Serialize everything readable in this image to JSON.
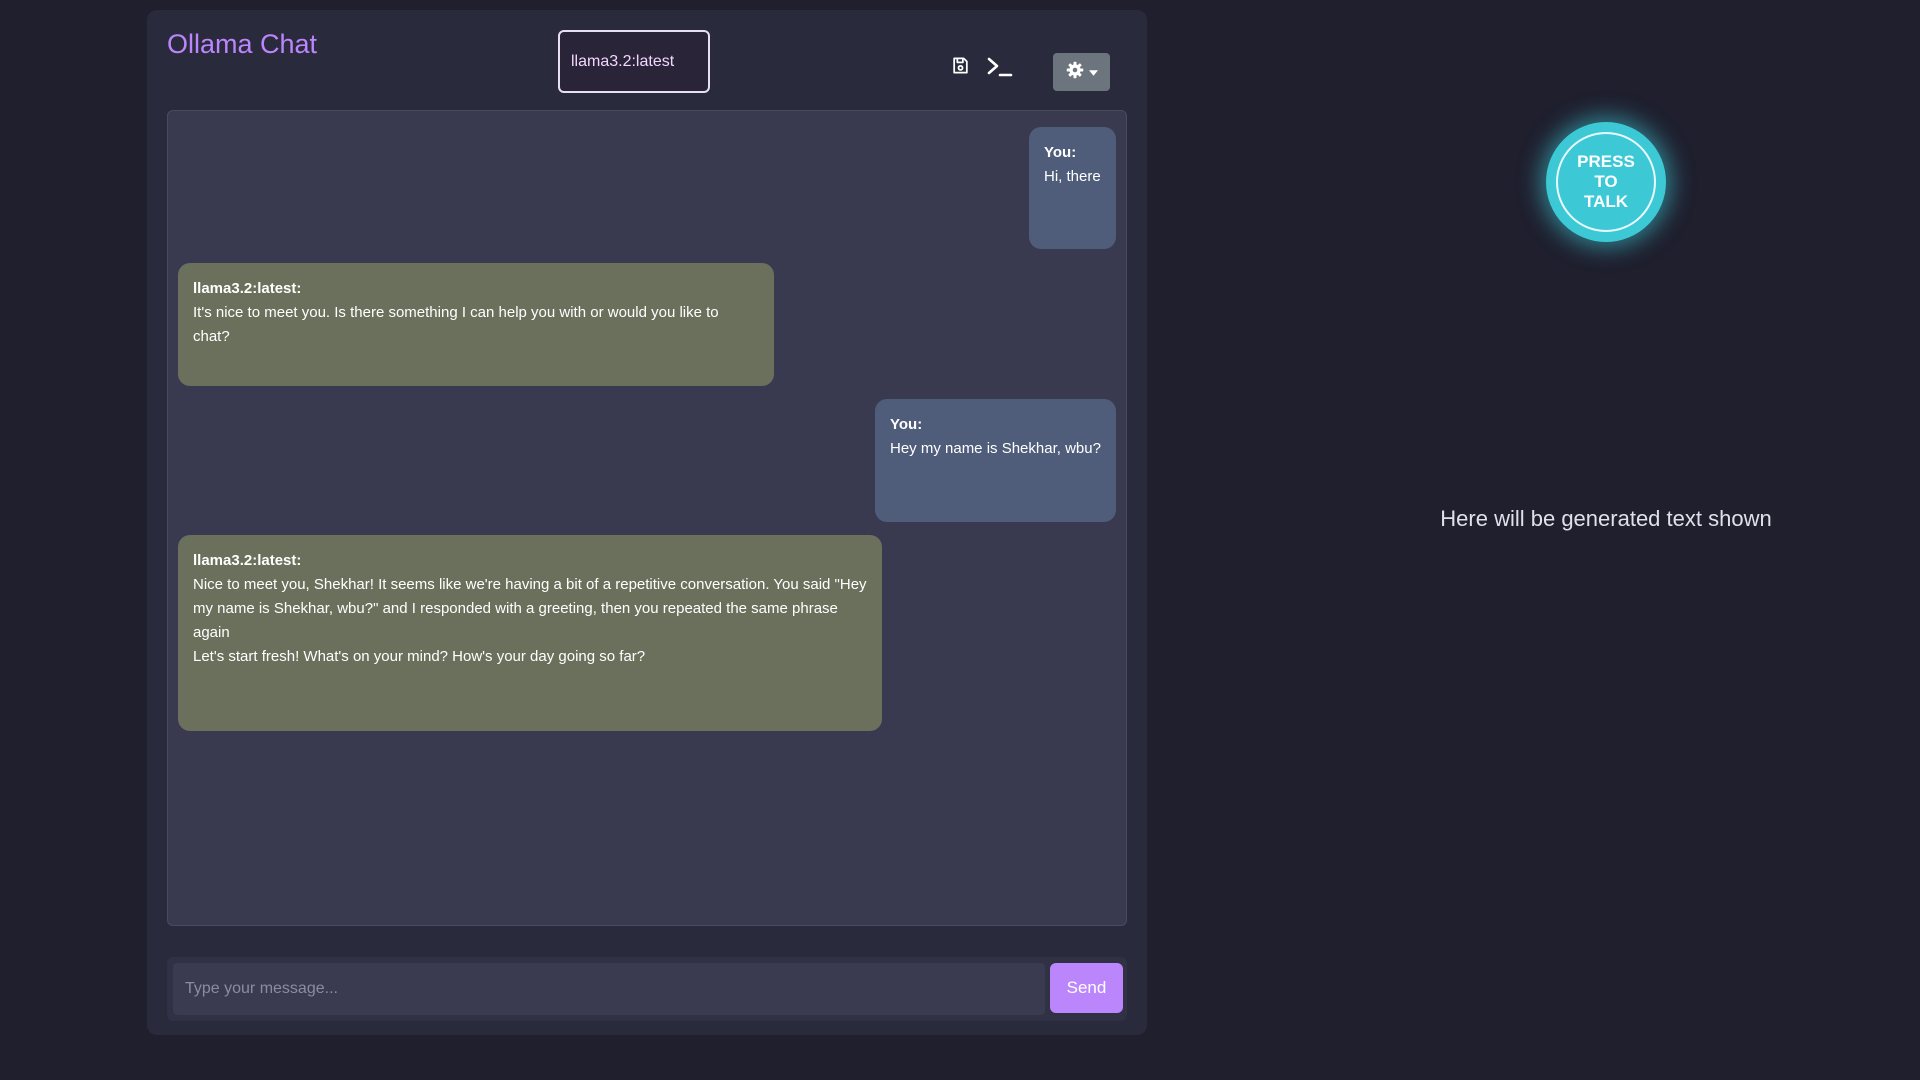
{
  "app": {
    "title": "Ollama Chat"
  },
  "header": {
    "model_selected": "llama3.2:latest",
    "icons": [
      "save-icon",
      "terminal-icon",
      "gear-icon"
    ]
  },
  "messages": [
    {
      "role": "user",
      "sender": "You:",
      "text": "Hi, there"
    },
    {
      "role": "assistant",
      "sender": "llama3.2:latest:",
      "text": "It's nice to meet you. Is there something I can help you with or would you like to chat?"
    },
    {
      "role": "user",
      "sender": "You:",
      "text": "Hey my name is Shekhar, wbu?"
    },
    {
      "role": "assistant",
      "sender": "llama3.2:latest:",
      "text": "Nice to meet you, Shekhar! It seems like we're having a bit of a repetitive conversation. You said \"Hey my name is Shekhar, wbu?\" and I responded with a greeting, then you repeated the same phrase again\nLet's start fresh! What's on your mind? How's your day going so far?"
    }
  ],
  "composer": {
    "placeholder": "Type your message...",
    "value": "",
    "send_label": "Send"
  },
  "voice": {
    "talk_label": "PRESS TO TALK",
    "generated_text": "Here will be generated text shown"
  },
  "colors": {
    "page_background": "#1f1f2e",
    "panel": "#2a2a3d",
    "accent": "#bb86fc",
    "user_bubble": "#4f5d7a",
    "assistant_bubble": "#6b705c",
    "talk_button": "#3dc8d6"
  }
}
